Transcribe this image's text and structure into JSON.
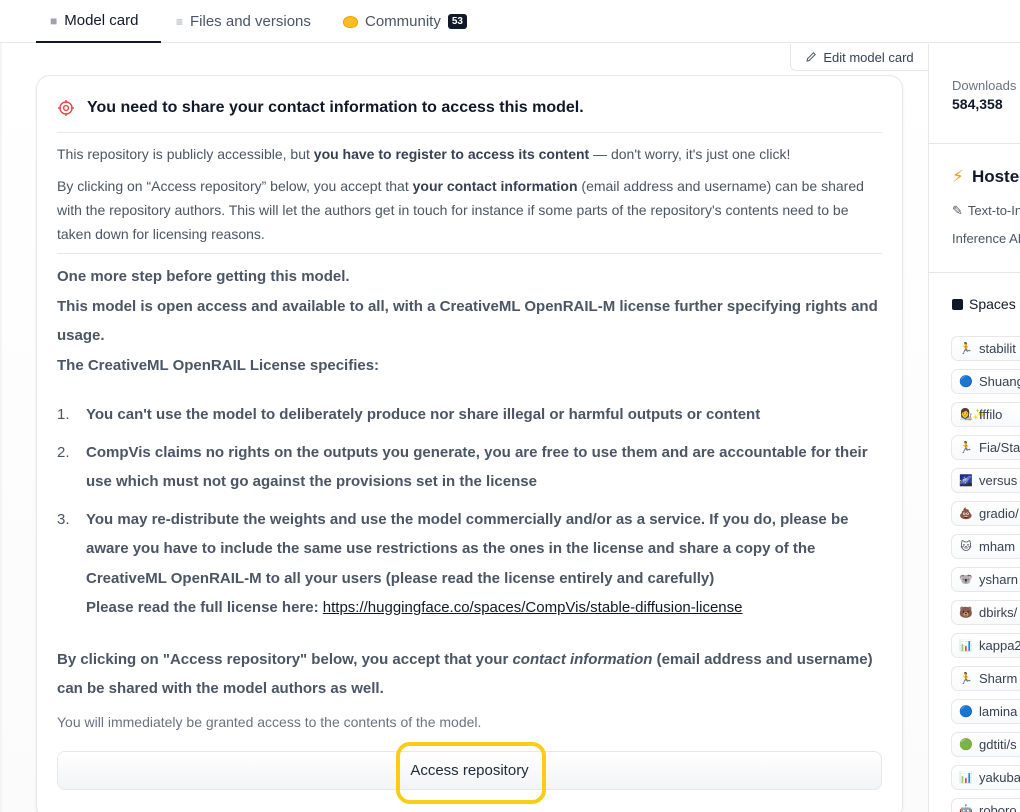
{
  "tabs": [
    {
      "label": "Model card",
      "icon": "cube-icon",
      "active": true
    },
    {
      "label": "Files and versions",
      "icon": "files-icon"
    },
    {
      "label": "Community",
      "icon": "community-icon",
      "badge": "53"
    }
  ],
  "edit_model_card": "Edit model card",
  "gate": {
    "title": "You need to share your contact information to access this model.",
    "p1_a": "This repository is publicly accessible, but ",
    "p1_b": "you have to register to access its content",
    "p1_c": " — don't worry, it's just one click!",
    "p2_a": "By clicking on “Access repository” below, you accept that ",
    "p2_b": "your contact information",
    "p2_c": " (email address and username) can be shared with the repository authors. This will let the authors get in touch for instance if some parts of the repository's contents need to be taken down for licensing reasons.",
    "lic_line1": "One more step before getting this model.",
    "lic_line2": "This model is open access and available to all, with a CreativeML OpenRAIL-M license further specifying rights and usage.",
    "lic_line3": "The CreativeML OpenRAIL License specifies:",
    "items": [
      {
        "num": "1.",
        "text": "You can't use the model to deliberately produce nor share illegal or harmful outputs or content"
      },
      {
        "num": "2.",
        "text": "CompVis claims no rights on the outputs you generate, you are free to use them and are accountable for their use which must not go against the provisions set in the license"
      },
      {
        "num": "3.",
        "text": "You may re-distribute the weights and use the model commercially and/or as a service. If you do, please be aware you have to include the same use restrictions as the ones in the license and share a copy of the CreativeML OpenRAIL-M to all your users (please read the license entirely and carefully)"
      }
    ],
    "read_full_prefix": "Please read the full license here: ",
    "license_link": "https://huggingface.co/spaces/CompVis/stable-diffusion-license",
    "access_note_a": "By clicking on \"Access repository\" below, you accept that your ",
    "access_note_b": "contact information",
    "access_note_c": " (email address and username) can be shared with the model authors as well.",
    "granted": "You will immediately be granted access to the contents of the model.",
    "button": "Access repository"
  },
  "sidebar": {
    "downloads_label": "Downloads",
    "downloads_value": "584,358",
    "hosted_title": "Hosted",
    "task": "Text-to-In",
    "inference": "Inference AF",
    "spaces_title": "Spaces",
    "spaces": [
      {
        "emoji": "🏃",
        "name": "stabilit"
      },
      {
        "emoji": "🔵",
        "name": "Shuang"
      },
      {
        "emoji": "👩‍🎨✨",
        "name": "fffilo"
      },
      {
        "emoji": "🏃",
        "name": "Fia/Sta"
      },
      {
        "emoji": "🌌",
        "name": "versus"
      },
      {
        "emoji": "💩",
        "name": "gradio/"
      },
      {
        "emoji": "🐱",
        "name": "mham"
      },
      {
        "emoji": "🐨",
        "name": "ysharn"
      },
      {
        "emoji": "🐻",
        "name": "dbirks/"
      },
      {
        "emoji": "📊",
        "name": "kappa2"
      },
      {
        "emoji": "🏃",
        "name": "Sharm"
      },
      {
        "emoji": "🔵",
        "name": "lamina"
      },
      {
        "emoji": "🟢",
        "name": "gdtiti/s"
      },
      {
        "emoji": "📊",
        "name": "yakuba"
      },
      {
        "emoji": "🤖",
        "name": "roboro"
      }
    ]
  },
  "colors": {
    "highlight": "#facc15",
    "accent": "#f59e0b"
  }
}
